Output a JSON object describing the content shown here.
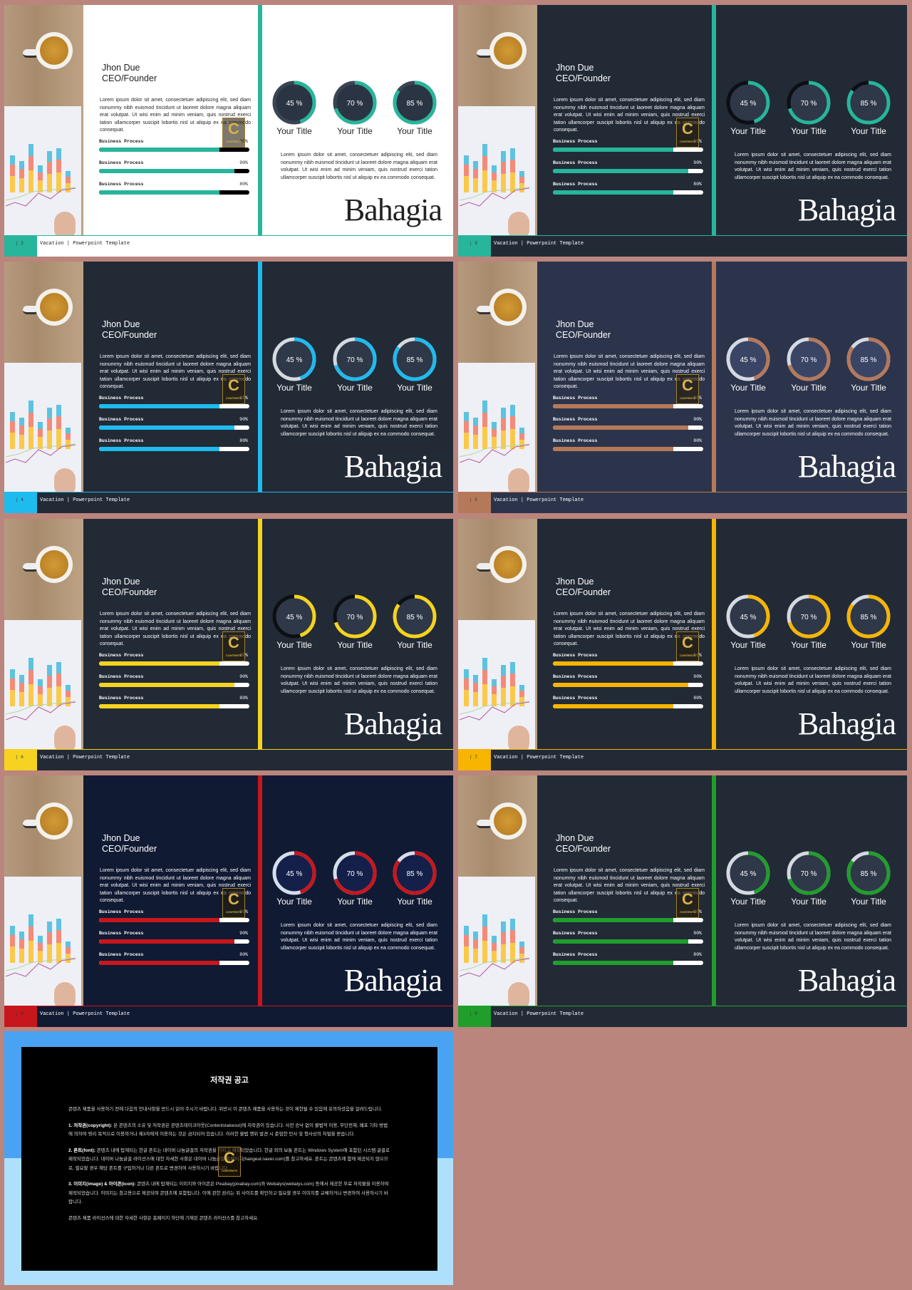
{
  "common": {
    "name": "Jhon Due",
    "role": "CEO/Founder",
    "para1": "Lorem ipsum dolor sit amet, consectetuer adipiscing elit, sed diam nonummy nibh euismod tincidunt ut laoreet dolore magna aliquam erat volutpat. Ut wisi enim ad minim veniam, quis nostrud exerci tation ullamcorper suscipit lobortis nisl ut aliquip ex ea commodo consequat.",
    "para2": "Lorem ipsum dolor sit amet, consectetuer adipiscing elit, sed diam nonummy nibh euismod tincidunt ut laoreet dolore magna aliquam erat volutpat. Ut wisi enim ad minim veniam, quis nostrud exerci tation ullamcorper suscipit lobortis nisl ut aliquip ex ea commodo consequat.",
    "bars": [
      {
        "label": "Business Process",
        "pct_label": "80%",
        "value": 80
      },
      {
        "label": "Business Process",
        "pct_label": "90%",
        "value": 90
      },
      {
        "label": "Business Process",
        "pct_label": "80%",
        "value": 80
      }
    ],
    "rings": [
      {
        "label": "45 %",
        "title": "Your Title",
        "value": 45
      },
      {
        "label": "70 %",
        "title": "Your Title",
        "value": 70
      },
      {
        "label": "85 %",
        "title": "Your Title",
        "value": 85
      }
    ],
    "brand": "Bahagia",
    "footer": "Vacation | Powerpoint Template",
    "watermark": "C",
    "watermark_sub": "CONTENTS"
  },
  "slides": [
    {
      "page": "| 2",
      "bg": "#ffffff",
      "text": "#222222",
      "accent": "#27b59b",
      "bar_track": "#000000",
      "ring_track": "#3a4453",
      "ring_fill": "#2b3443",
      "ring_text": "#ffffff"
    },
    {
      "page": "| 3",
      "bg": "#222a36",
      "text": "#ffffff",
      "accent": "#27b59b",
      "bar_track": "#ffffff",
      "ring_track": "#0c0f14",
      "ring_fill": "#2f3848",
      "ring_text": "#ffffff"
    },
    {
      "page": "| 4",
      "bg": "#222a36",
      "text": "#ffffff",
      "accent": "#1ebbee",
      "bar_track": "#ffffff",
      "ring_track": "#d5d9e0",
      "ring_fill": "#2f3848",
      "ring_text": "#ffffff"
    },
    {
      "page": "| 5",
      "bg": "#2c344b",
      "text": "#ffffff",
      "accent": "#b5795a",
      "bar_track": "#ffffff",
      "ring_track": "#d5d9e0",
      "ring_fill": "#3a4566",
      "ring_text": "#ffffff"
    },
    {
      "page": "| 6",
      "bg": "#222a36",
      "text": "#ffffff",
      "accent": "#f5d320",
      "bar_track": "#ffffff",
      "ring_track": "#0c0f14",
      "ring_fill": "#2f3848",
      "ring_text": "#ffffff"
    },
    {
      "page": "| 7",
      "bg": "#222a36",
      "text": "#ffffff",
      "accent": "#f7b400",
      "bar_track": "#ffffff",
      "ring_track": "#d5d9e0",
      "ring_fill": "#2f3848",
      "ring_text": "#ffffff"
    },
    {
      "page": "| 8",
      "bg": "#111a33",
      "text": "#ffffff",
      "accent": "#c8161d",
      "bar_track": "#ffffff",
      "ring_track": "#d5ddeb",
      "ring_fill": "#14204a",
      "ring_text": "#ffffff"
    },
    {
      "page": "| 9",
      "bg": "#222a36",
      "text": "#ffffff",
      "accent": "#1f9e2c",
      "bar_track": "#ffffff",
      "ring_track": "#d5d9e0",
      "ring_fill": "#2f3848",
      "ring_text": "#ffffff"
    }
  ],
  "copyright": {
    "title": "저작권 공고",
    "intro": "콘텐츠 제품을 사용하기 전에 다음의 안내사항을 반드시 읽어 주시기 바랍니다. 위반시 이 콘텐츠 제품을 사용하는 것이 제한될 수 있음에 유의하셨음을 알려드립니다.",
    "items": [
      {
        "head": "1. 저작권(copyright):",
        "body": " 본 콘텐츠의 소유 및 저작권은 콘텐츠테이크아웃(Contentstakeout)에 저작권이 있습니다. 사전 승낙 없이 불법적 이용, 무단전재, 배포 기타 방법에 의하여 영리 목적으로 이용하거나 제3자에게 이용하는 것은 금지되어 있습니다. 이러한 불법 행위 발견 시 준엄한 민사 및 형사상의 처벌을 받습니다."
      },
      {
        "head": "2. 폰트(font):",
        "body": " 콘텐츠 내에 탑재되는 한글 폰트는 네이버 나눔글꼴의 저작권을 가지고 제작되었습니다. 한글 외의 보통 폰트는 Windows System에 포함된 시스템 글꼴로 제작되었습니다. 네이버 나눔글꼴 라이선스에 대한 자세한 사항은 네이버 나눔글꼴 홈페이지(hangeul.naver.com)를 참고하세요. 폰트는 콘텐츠에 함께 제공되지 않으므로, 필요할 경우 해당 폰트를 구입하거나 다른 폰트로 변경하여 사용하시기 바랍니다."
      },
      {
        "head": "3. 이미지(image) & 아이콘(icon):",
        "body": " 콘텐츠 내에 탑재되는 이미지와 아이콘은 Pixabay(pixabay.com)와 Webalys(webalys.com) 등에서 제공한 무료 저작물을 이용하여 제작되었습니다. 이미지는 참고용으로 제공되며 콘텐츠에 포함됩니다. 이에 관한 권리는 위 사이트를 확인하고 필요할 경우 이미지를 교체하거나 변경하여 사용하시기 바랍니다."
      }
    ],
    "outro": "콘텐츠 제품 라이선스에 대한 자세한 사항은 홈페이지 하단에 기재된 콘텐츠 라이선스를 참고하세요."
  }
}
